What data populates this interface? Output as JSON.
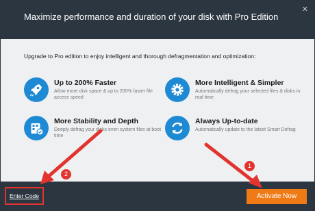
{
  "dialog": {
    "title": "Maximize performance and duration of your disk with Pro Edition",
    "close_label": "✕"
  },
  "intro": "Upgrade to Pro edition to enjoy intelligent and thorough defragmentation and optimization:",
  "features": [
    {
      "icon": "rocket-icon",
      "title": "Up to 200% Faster",
      "desc": "Allow more disk space & up to 200% faster file access speed"
    },
    {
      "icon": "gear-icon",
      "title": "More Intelligent & Simpler",
      "desc": "Automatically defrag your selected files & disks in real time"
    },
    {
      "icon": "disk-stability-icon",
      "title": "More Stability and Depth",
      "desc": "Deeply defrag your disks even system files at boot time"
    },
    {
      "icon": "refresh-icon",
      "title": "Always Up-to-date",
      "desc": "Automatically update to the latest Smart Defrag"
    }
  ],
  "footer": {
    "enter_code": "Enter Code",
    "activate": "Activate Now"
  },
  "annotations": {
    "badge_1": "1",
    "badge_2": "2",
    "color": "#e2332f"
  },
  "colors": {
    "header_bg": "#2c3641",
    "body_bg": "#eef0f2",
    "icon_blue": "#1f8ad4",
    "button_orange": "#f07b16"
  }
}
